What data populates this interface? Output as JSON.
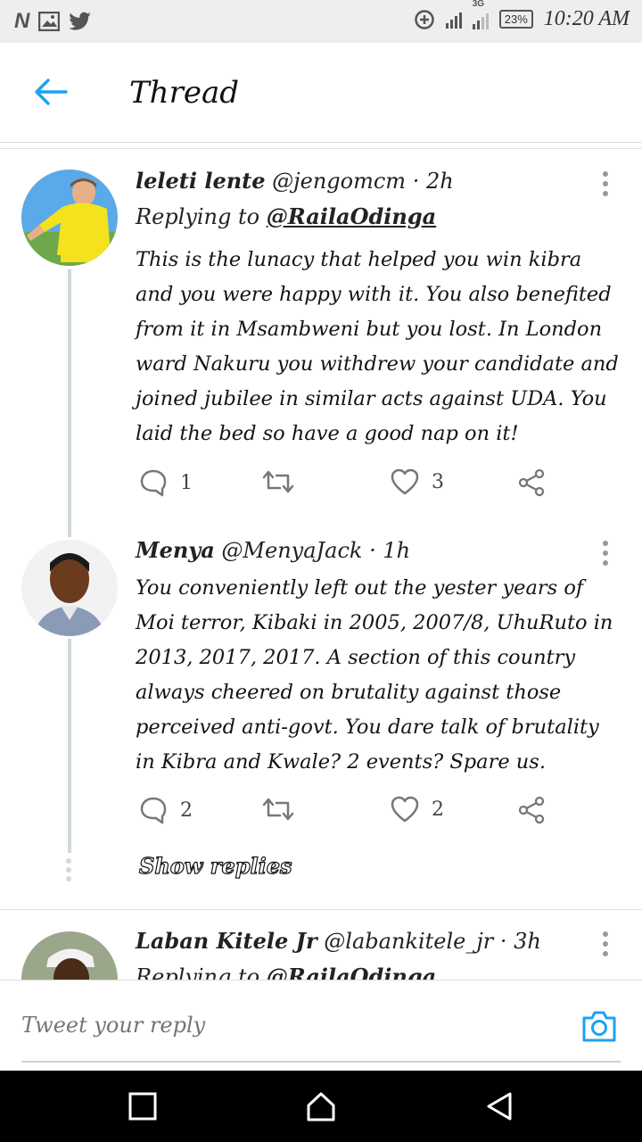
{
  "status_bar": {
    "left_icons": [
      "netflix-icon",
      "image-icon",
      "twitter-icon"
    ],
    "right_icons": [
      "data-saver-icon",
      "signal-icon",
      "3g-icon",
      "signal-icon"
    ],
    "network": "3G",
    "battery": "23%",
    "time": "10:20 AM"
  },
  "header": {
    "title": "Thread",
    "back_icon": "back-arrow-icon"
  },
  "tweets": [
    {
      "name": "leleti lente",
      "handle": "@jengomcm",
      "time": "· 2h",
      "replying_prefix": "Replying to",
      "replying_to": "@RailaOdinga",
      "text": "This is the lunacy that helped you win kibra and you were happy with it. You also benefited from it in Msambweni but you lost. In London ward Nakuru you withdrew your candidate and joined jubilee in similar acts against UDA. You laid the bed so have a good nap on it!",
      "replies": "1",
      "retweets": "",
      "likes": "3"
    },
    {
      "name": "Menya",
      "handle": "@MenyaJack",
      "time": "· 1h",
      "text": "You conveniently left out the yester years of Moi terror, Kibaki in 2005, 2007/8, UhuRuto in 2013, 2017, 2017. A section of this country always cheered on brutality against those perceived anti-govt. You dare talk of brutality in Kibra and Kwale? 2 events? Spare us.",
      "replies": "2",
      "retweets": "",
      "likes": "2",
      "show_replies": "Show replies"
    },
    {
      "name": "Laban Kitele Jr",
      "handle": "@labankitele_jr",
      "time": "· 3h",
      "replying_prefix": "Replying to",
      "replying_to": "@RailaOdinga"
    }
  ],
  "reply_bar": {
    "placeholder": "Tweet your reply",
    "camera_icon": "camera-icon"
  },
  "nav_bar": {
    "icons": [
      "recents-square-icon",
      "home-icon",
      "back-triangle-icon"
    ]
  },
  "colors": {
    "accent": "#1da1f2",
    "thread_line": "#cfd9de"
  }
}
